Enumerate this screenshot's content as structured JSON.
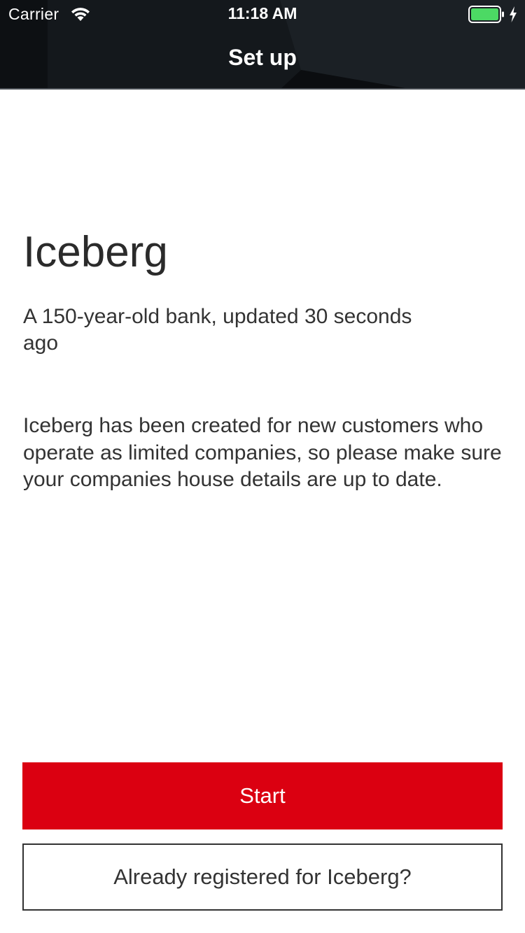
{
  "status_bar": {
    "carrier": "Carrier",
    "time": "11:18 AM",
    "wifi_icon": "wifi-icon",
    "battery_icon": "battery-icon",
    "charging_icon": "charging-bolt-icon",
    "battery_color": "#4cd964"
  },
  "nav": {
    "title": "Set up"
  },
  "main": {
    "app_name": "Iceberg",
    "tagline": "A 150-year-old bank, updated 30 seconds ago",
    "description": "Iceberg has been created for new customers who operate as limited companies, so please make sure your companies house details are up to date."
  },
  "actions": {
    "start_label": "Start",
    "registered_label": "Already registered for Iceberg?"
  },
  "colors": {
    "header_background": "#14181c",
    "primary_button": "#db0011",
    "text": "#333333"
  }
}
